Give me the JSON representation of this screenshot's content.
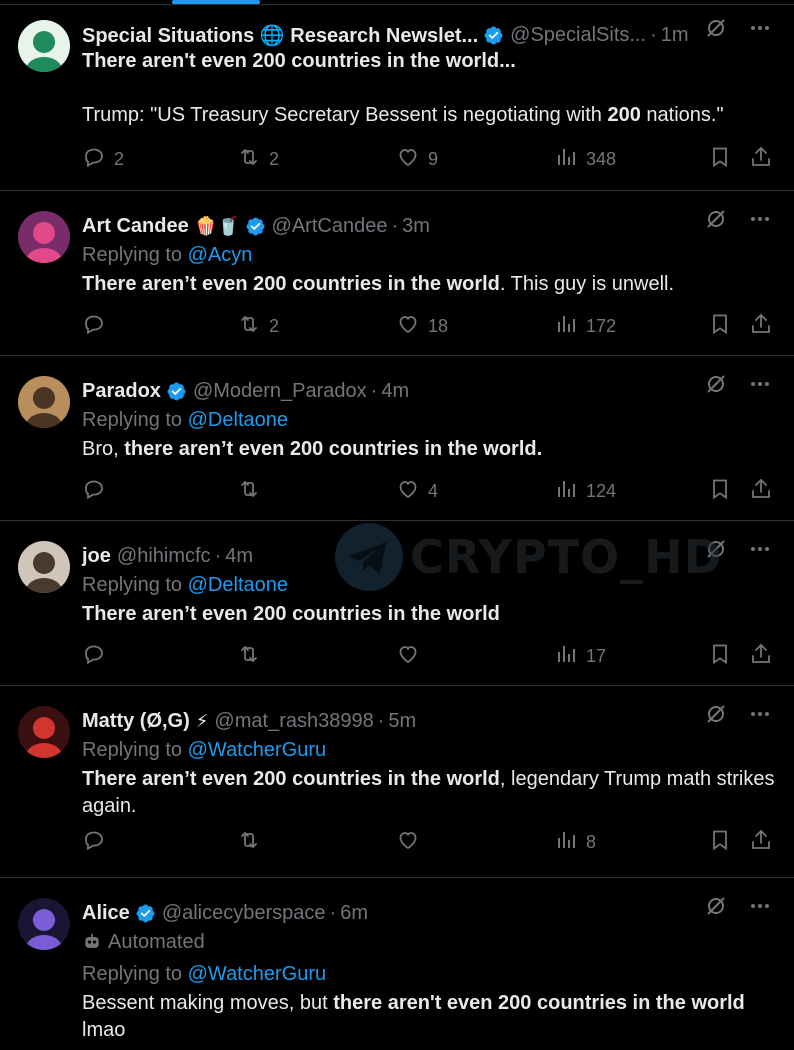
{
  "tweets": [
    {
      "name": "Special Situations 🌐 Research Newslet...",
      "verified": true,
      "handle": "@SpecialSits...",
      "time": "1m",
      "time_sep": "·",
      "replying_to": "",
      "body_html": "<b>There aren't even 200 countries in the world...</b><br><br>Trump: \"US Treasury Secretary Bessent is negotiating with <b>200</b> nations.\"",
      "replies": "2",
      "retweets": "2",
      "likes": "9",
      "views": "348"
    },
    {
      "name": "Art Candee",
      "emoji": "🍿🥤",
      "verified": true,
      "handle": "@ArtCandee",
      "time": "3m",
      "time_sep": "·",
      "replying_to": "@Acyn",
      "body_html": "<b>There aren’t even 200 countries in the world</b>. This guy is unwell.",
      "replies": "",
      "retweets": "2",
      "likes": "18",
      "views": "172"
    },
    {
      "name": "Paradox",
      "verified": true,
      "handle": "@Modern_Paradox",
      "time": "4m",
      "time_sep": "·",
      "replying_to": "@Deltaone",
      "body_html": "Bro, <b>there aren’t even 200 countries in the world.</b>",
      "replies": "",
      "retweets": "",
      "likes": "4",
      "views": "124"
    },
    {
      "name": "joe",
      "verified": false,
      "handle": "@hihimcfc",
      "time": "4m",
      "time_sep": "·",
      "replying_to": "@Deltaone",
      "body_html": "<b>There aren’t even 200 countries in the world</b>",
      "replies": "",
      "retweets": "",
      "likes": "",
      "views": "17"
    },
    {
      "name": "Matty (Ø,G)",
      "emoji": "⚡",
      "verified": false,
      "handle": "@mat_rash38998",
      "time": "5m",
      "time_sep": "·",
      "replying_to": "@WatcherGuru",
      "body_html": "<b>There aren’t even 200 countries in the world</b>, legendary Trump math strikes again.",
      "replies": "",
      "retweets": "",
      "likes": "",
      "views": "8"
    },
    {
      "name": "Alice",
      "verified": true,
      "handle": "@alicecyberspace",
      "time": "6m",
      "time_sep": "·",
      "automated": "Automated",
      "replying_to": "@WatcherGuru",
      "body_html": "Bessent making moves, but <b>there aren't even 200 countries in the world</b> lmao",
      "replies": "",
      "retweets": "",
      "likes": "",
      "views": ""
    }
  ],
  "replying_prefix": "Replying to",
  "watermark": "CRYPTO_HD",
  "colors": {
    "accent": "#1d9bf0",
    "muted": "#71767b",
    "divider": "#2f3336",
    "text": "#e7e9ea"
  }
}
